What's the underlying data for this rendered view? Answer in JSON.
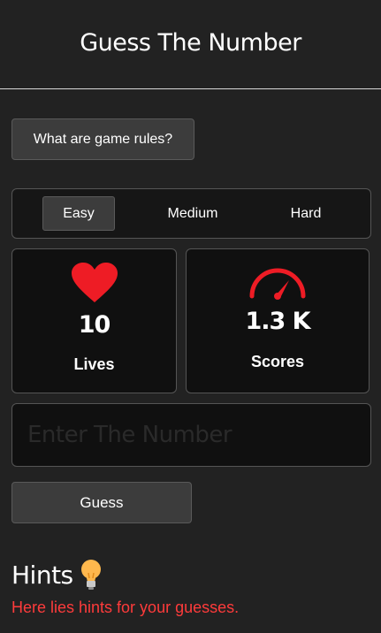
{
  "header": {
    "title": "Guess The Number"
  },
  "rules_button": {
    "label": "What are game rules?"
  },
  "difficulty": {
    "options": [
      "Easy",
      "Medium",
      "Hard"
    ],
    "selected": "Easy"
  },
  "stats": {
    "lives": {
      "value": "10",
      "label": "Lives",
      "icon": "heart-icon"
    },
    "scores": {
      "value": "1.3 K",
      "label": "Scores",
      "icon": "speedometer-icon"
    }
  },
  "guess_input": {
    "value": "",
    "placeholder": "Enter The Number"
  },
  "guess_button": {
    "label": "Guess"
  },
  "hints": {
    "title": "Hints",
    "icon": "lightbulb-icon",
    "text": "Here lies hints for your guesses."
  },
  "colors": {
    "background": "#222222",
    "card": "#101010",
    "button": "#3c3c3c",
    "accent_red": "#ee1c25",
    "hint_red": "#ff3b3b"
  }
}
